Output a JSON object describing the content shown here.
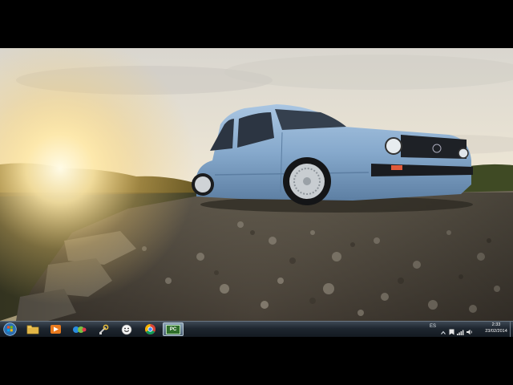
{
  "desktop": {
    "wallpaper_icon": "vw-golf-car-sunset-wallpaper",
    "colors": {
      "sky": "#e8e2d4",
      "sun": "#ffd36a",
      "car": "#8fb2d4",
      "rocks": "#6d655c"
    }
  },
  "taskbar": {
    "start_icon": "windows-start-orb",
    "pinned": [
      {
        "name": "explorer",
        "icon": "folder-icon"
      },
      {
        "name": "media-player",
        "icon": "media-player-icon"
      },
      {
        "name": "messenger",
        "icon": "messenger-icon"
      },
      {
        "name": "tools",
        "icon": "wrench-icon"
      },
      {
        "name": "smiley-app",
        "icon": "smiley-icon"
      },
      {
        "name": "chrome",
        "icon": "chrome-icon"
      },
      {
        "name": "pc-app",
        "icon": "pc-icon",
        "label": "PC",
        "active": true
      }
    ],
    "tray": {
      "icons": [
        "language-indicator-icon",
        "show-hidden-icons-icon",
        "action-center-icon",
        "network-signal-icon",
        "volume-icon"
      ],
      "language": "ES",
      "time": "2:33",
      "date": "23/02/2014"
    }
  }
}
